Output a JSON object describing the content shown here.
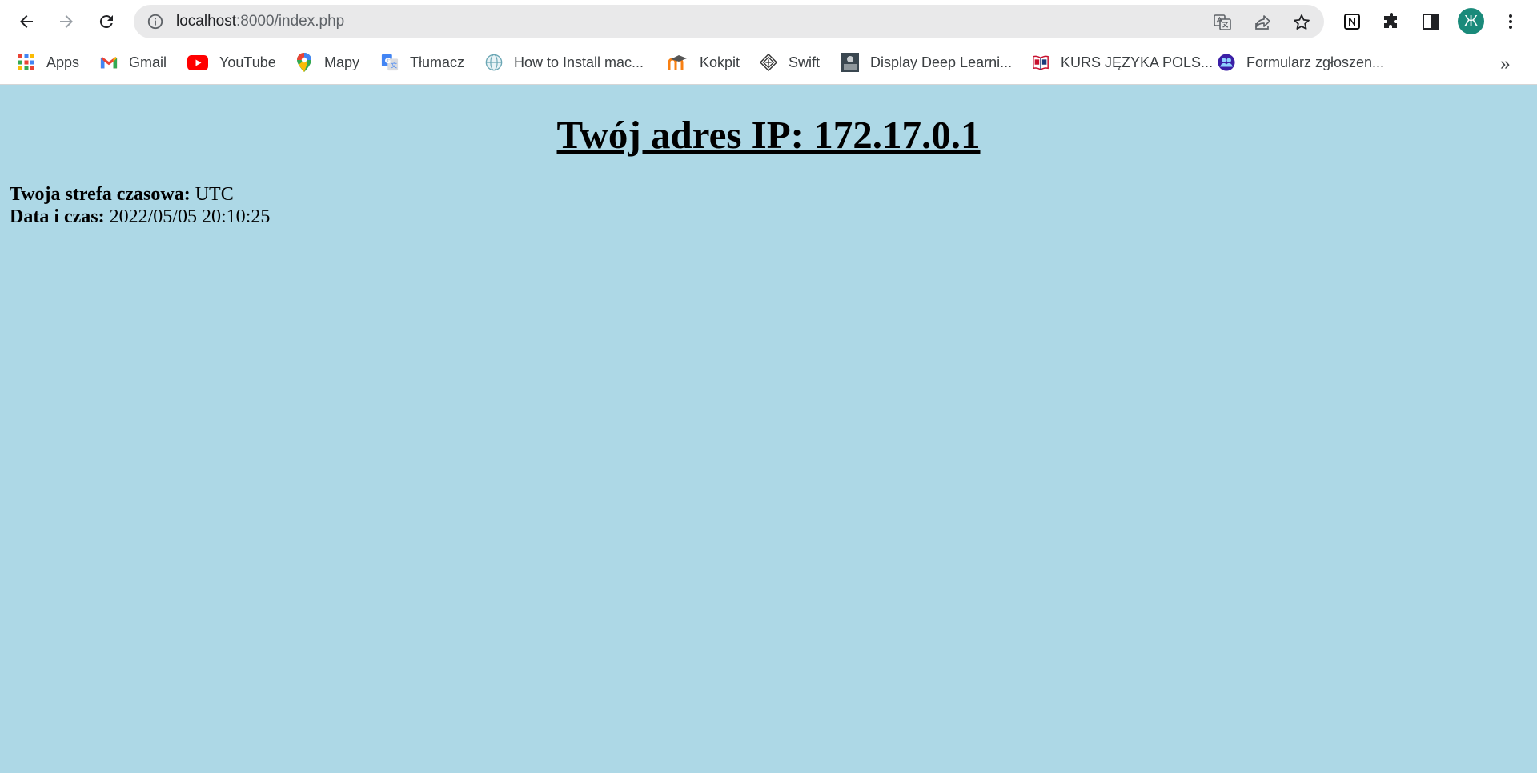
{
  "browser": {
    "address_host": "localhost",
    "address_path": ":8000/index.php",
    "avatar_letter": "Ж",
    "bookmarks_more": "»",
    "bookmarks": [
      {
        "label": "Apps",
        "icon": "apps-grid-icon"
      },
      {
        "label": "Gmail",
        "icon": "gmail-icon"
      },
      {
        "label": "YouTube",
        "icon": "youtube-icon"
      },
      {
        "label": "Mapy",
        "icon": "maps-pin-icon"
      },
      {
        "label": "Tłumacz",
        "icon": "translate-icon"
      },
      {
        "label": "How to Install mac...",
        "icon": "site-globe-icon"
      },
      {
        "label": "Kokpit",
        "icon": "moodle-icon"
      },
      {
        "label": "Swift",
        "icon": "swift-icon"
      },
      {
        "label": "Display Deep Learni...",
        "icon": "page-thumbnail-icon"
      },
      {
        "label": "KURS JĘZYKA POLS...",
        "icon": "book-icon"
      },
      {
        "label": "Formularz zgłoszen...",
        "icon": "forms-icon"
      }
    ]
  },
  "page": {
    "headline": "Twój adres IP: 172.17.0.1",
    "timezone_label": "Twoja strefa czasowa:",
    "timezone_value": " UTC",
    "datetime_label": "Data i czas:",
    "datetime_value": " 2022/05/05 20:10:25",
    "background": "#add8e6"
  }
}
